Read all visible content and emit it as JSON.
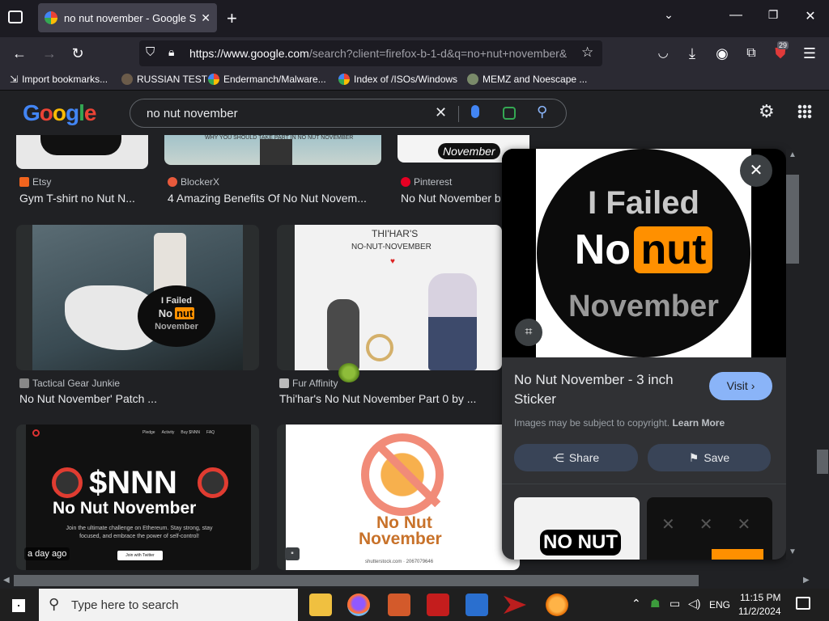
{
  "browser": {
    "tab_title": "no nut november - Google Sear",
    "url_domain": "https://www.google.com",
    "url_path": "/search?client=firefox-b-1-d&q=no+nut+november&",
    "extensions_badge": "29"
  },
  "bookmarks": [
    {
      "label": "Import bookmarks...",
      "color": "#fbfbfe"
    },
    {
      "label": "RUSSIAN TEST",
      "color": "#6b5b4a"
    },
    {
      "label": "Endermanch/Malware...",
      "color": "#4285f4"
    },
    {
      "label": "Index of /ISOs/Windows",
      "color": "#4285f4"
    },
    {
      "label": "MEMZ and Noescape ...",
      "color": "#888888"
    }
  ],
  "google": {
    "logo_text": "Google",
    "query": "no nut november"
  },
  "results": {
    "row1": [
      {
        "source": "Etsy",
        "caption": "Gym T-shirt no Nut N..."
      },
      {
        "source": "BlockerX",
        "caption": "4 Amazing Benefits Of No Nut Novem..."
      },
      {
        "source": "Pinterest",
        "caption": "No Nut November b"
      }
    ],
    "row2": [
      {
        "source": "Tactical Gear Junkie",
        "caption": "No Nut November' Patch ..."
      },
      {
        "source": "Fur Affinity",
        "caption": "Thi'har's No Nut November Part 0 by ..."
      }
    ],
    "row3": [
      {
        "badge": "a day ago",
        "title_big": "$NNN",
        "title_sub": "No Nut November",
        "blurb": "Join the ultimate challenge on Ethereum. Stay strong, stay focused, and embrace the power of self-control!",
        "cta": "Join with Twitter",
        "nav": [
          "Pledge",
          "Activity",
          "Buy $NNN",
          "FAQ"
        ]
      },
      {
        "line1": "No Nut",
        "line2": "November",
        "credit": "shutterstock.com · 2067079646"
      }
    ],
    "thumb_texts": {
      "pinterest": "November",
      "blockerx": "WHY YOU SHOULD TAKE PART IN NO NUT NOVEMBER",
      "patch_l1": "I Failed",
      "patch_l2": "No",
      "patch_l3": "nut",
      "patch_l4": "November",
      "art_title1": "THI'HAR'S",
      "art_title2": "NO-NUT-NOVEMBER"
    }
  },
  "panel": {
    "image_l1": "I Failed",
    "image_l2": "No",
    "image_l3": "nut",
    "image_l4": "November",
    "title": "No Nut November - 3 inch Sticker",
    "visit": "Visit",
    "copyright": "Images may be subject to copyright.",
    "learn_more": "Learn More",
    "share": "Share",
    "save": "Save",
    "related_text": "NO NUT"
  },
  "taskbar": {
    "search_placeholder": "Type here to search",
    "lang": "ENG",
    "time": "11:15 PM",
    "date": "11/2/2024"
  },
  "colors": {
    "orange": "#ff9000",
    "accent_blue": "#8ab4f8"
  }
}
